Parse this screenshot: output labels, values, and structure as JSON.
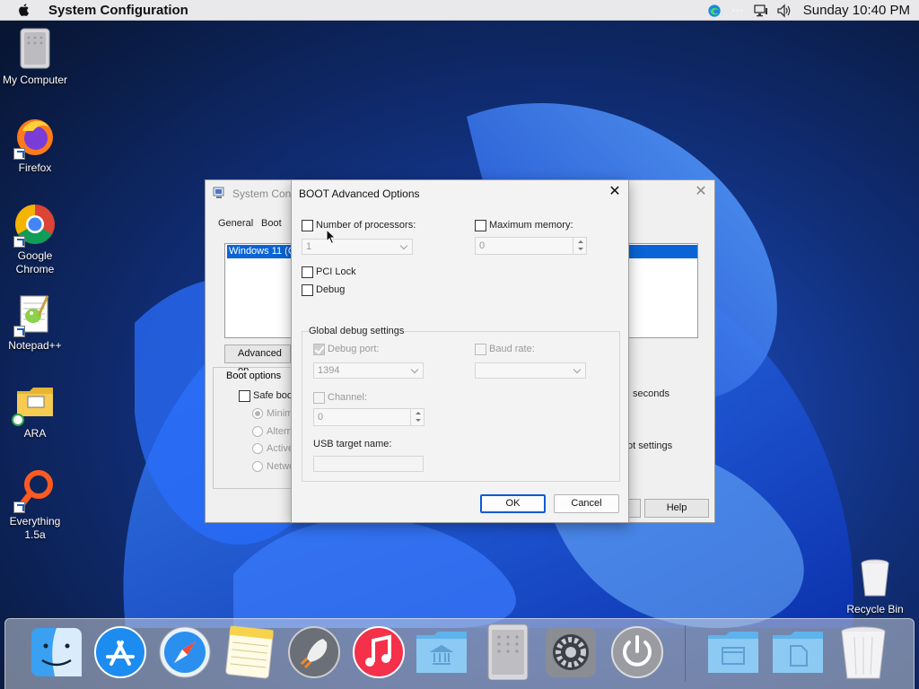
{
  "menubar": {
    "app_title": "System Configuration",
    "clock": "Sunday 10:40 PM"
  },
  "desktop": {
    "icons": [
      {
        "label": "My Computer"
      },
      {
        "label": "Firefox"
      },
      {
        "label": "Google Chrome"
      },
      {
        "label": "Notepad++"
      },
      {
        "label": "ARA"
      },
      {
        "label": "Everything 1.5a"
      },
      {
        "label": "Recycle Bin"
      }
    ]
  },
  "syscfg": {
    "title": "System Conf",
    "tabs": [
      "General",
      "Boot"
    ],
    "os_entry": "Windows 11 (C",
    "advanced_button": "Advanced op",
    "boot_options_label": "Boot options",
    "safe_boot": "Safe boo",
    "radios": [
      "Minim",
      "Altern",
      "Active",
      "Netwo"
    ],
    "seconds": "seconds",
    "boot_settings": "ot settings",
    "help": "Help"
  },
  "dialog": {
    "title": "BOOT Advanced Options",
    "num_processors_label": "Number of processors:",
    "num_processors_value": "1",
    "max_memory_label": "Maximum memory:",
    "max_memory_value": "0",
    "pci_lock": "PCI Lock",
    "debug": "Debug",
    "global_debug_label": "Global debug settings",
    "debug_port_label": "Debug port:",
    "debug_port_value": "1394",
    "baud_rate_label": "Baud rate:",
    "channel_label": "Channel:",
    "channel_value": "0",
    "usb_target_label": "USB target name:",
    "ok": "OK",
    "cancel": "Cancel"
  },
  "dock": {
    "items": [
      "finder-icon",
      "app-store-icon",
      "safari-icon",
      "notes-icon",
      "launchpad-icon",
      "music-icon",
      "library-folder-icon",
      "mac-pro-icon",
      "system-preferences-icon",
      "power-icon",
      "documents-folder-icon",
      "files-folder-icon",
      "trash-icon"
    ]
  },
  "colors": {
    "selection_blue": "#0a64d6",
    "ok_border": "#0a5ad6"
  }
}
